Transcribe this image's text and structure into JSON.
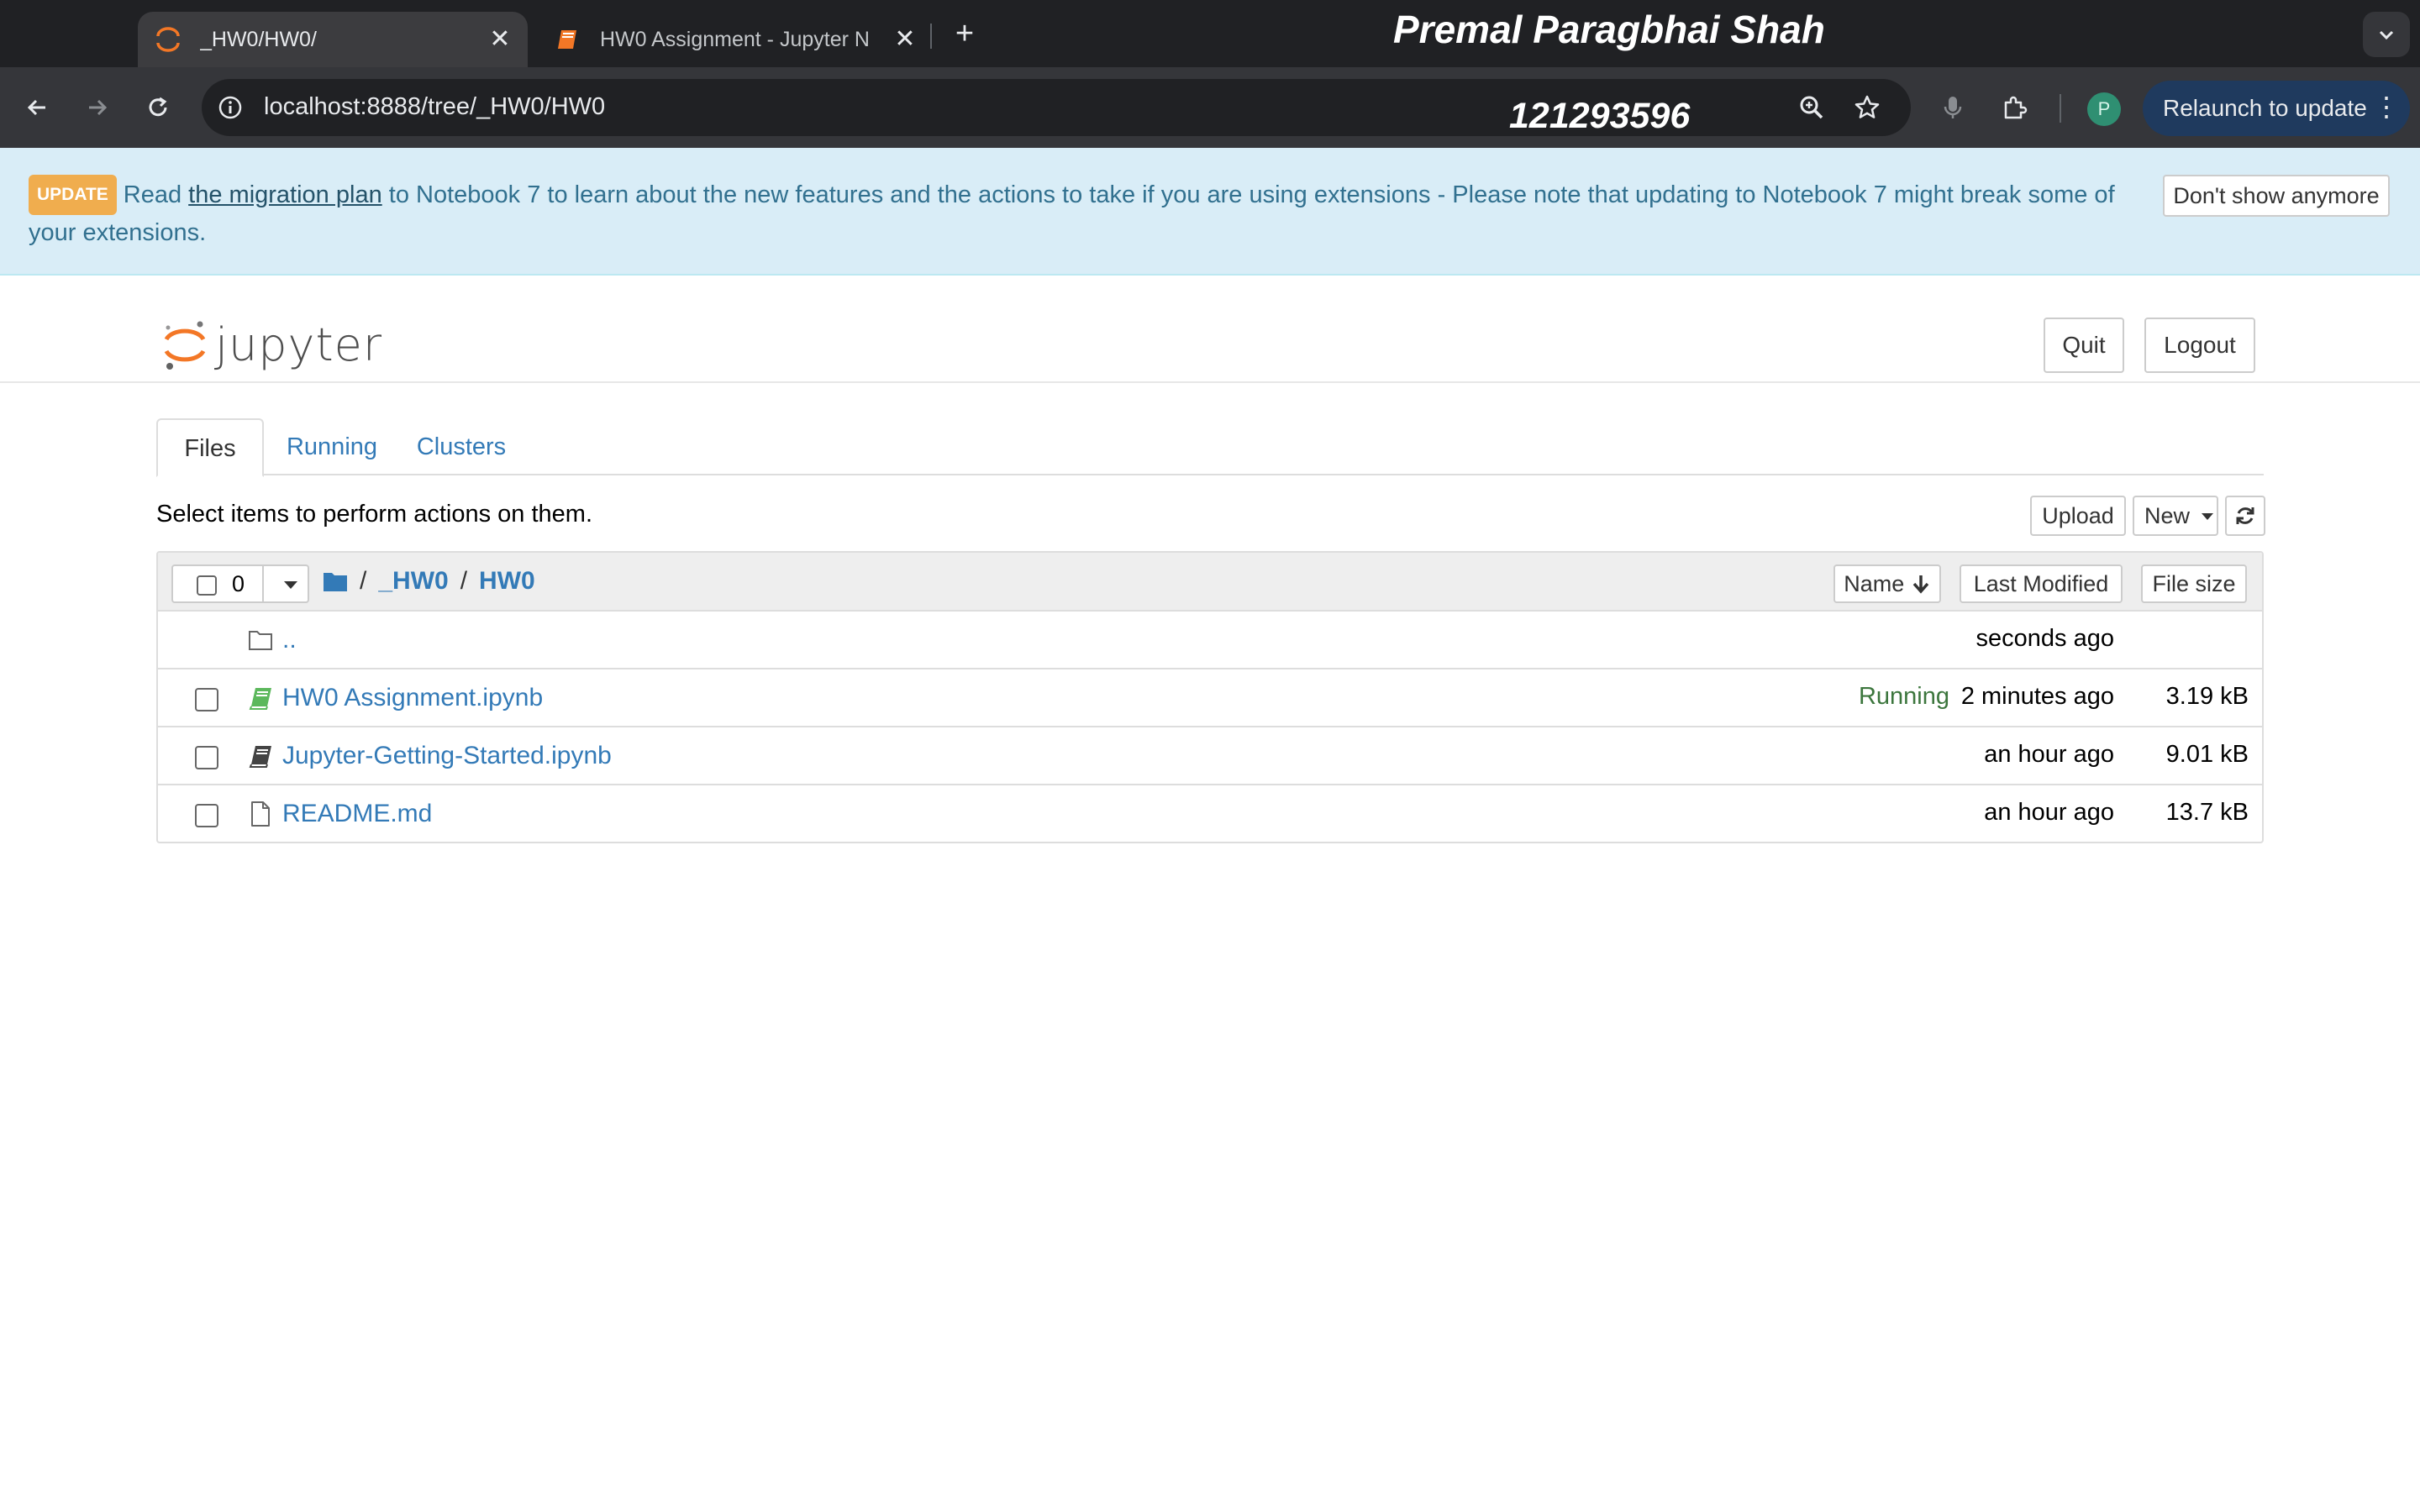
{
  "browser": {
    "tabs": [
      {
        "title": "_HW0/HW0/",
        "active": true,
        "icon": "jupyter-favicon-icon"
      },
      {
        "title": "HW0 Assignment - Jupyter N",
        "active": false,
        "icon": "notebook-favicon-icon"
      }
    ],
    "new_tab_label": "+",
    "close_symbol": "✕",
    "address": "localhost:8888/tree/_HW0/HW0",
    "profile_initial": "P",
    "relaunch_label": "Relaunch to update",
    "menu_symbol": "⋮"
  },
  "overlay": {
    "name": "Premal Paragbhai Shah",
    "id_number": "121293596"
  },
  "banner": {
    "badge": "UPDATE",
    "text_before": "Read ",
    "link": "the migration plan",
    "text_after": " to Notebook 7 to learn about the new features and the actions to take if you are using extensions - Please note that updating to Notebook 7 might break some of your extensions.",
    "dismiss_label": "Don't show anymore",
    "colors": {
      "background": "#d9edf7",
      "text": "#31708f",
      "badge": "#f0ad4e"
    }
  },
  "header": {
    "logo_text": "jupyter",
    "quit_label": "Quit",
    "logout_label": "Logout"
  },
  "tabs": [
    {
      "label": "Files",
      "active": true
    },
    {
      "label": "Running",
      "active": false
    },
    {
      "label": "Clusters",
      "active": false
    }
  ],
  "file_toolbar": {
    "instruction": "Select items to perform actions on them.",
    "upload_label": "Upload",
    "new_label": "New",
    "refresh_icon": "refresh-icon"
  },
  "list_header": {
    "selected_count": "0",
    "breadcrumb": [
      "_HW0",
      "HW0"
    ],
    "sort_name_label": "Name",
    "sort_modified_label": "Last Modified",
    "sort_size_label": "File size"
  },
  "files": [
    {
      "name": "..",
      "type": "parent-folder",
      "status": "",
      "modified": "seconds ago",
      "size": ""
    },
    {
      "name": "HW0 Assignment.ipynb",
      "type": "notebook-running",
      "status": "Running",
      "modified": "2 minutes ago",
      "size": "3.19 kB"
    },
    {
      "name": "Jupyter-Getting-Started.ipynb",
      "type": "notebook",
      "status": "",
      "modified": "an hour ago",
      "size": "9.01 kB"
    },
    {
      "name": "README.md",
      "type": "file",
      "status": "",
      "modified": "an hour ago",
      "size": "13.7 kB"
    }
  ]
}
